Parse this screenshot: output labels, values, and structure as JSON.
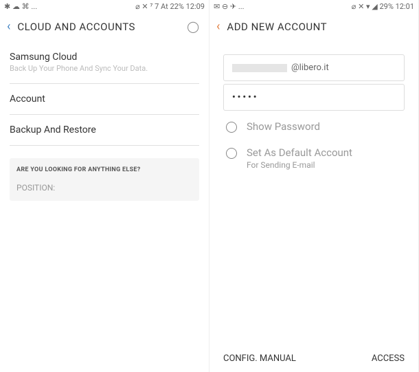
{
  "left": {
    "status": {
      "left_icons": "✱ ☁ ⌘ ...",
      "right_text": "⌀ ✕ ⁷ 7 At 22% 12:09"
    },
    "header": {
      "title": "CLOUD AND ACCOUNTS"
    },
    "items": [
      {
        "title": "Samsung Cloud",
        "subtitle": "Back Up Your Phone And Sync Your Data."
      },
      {
        "title": "Account"
      },
      {
        "title": "Backup And Restore"
      }
    ],
    "searchbox": {
      "heading": "ARE YOU LOOKING FOR ANYTHING ELSE?",
      "position_label": "POSITION:"
    }
  },
  "right": {
    "status": {
      "left_icons": "✉ ⊖ ✈ ...",
      "right_text": "⌀ ✕ ▾ ◢ 29% 12:01"
    },
    "header": {
      "title": "ADD NEW ACCOUNT"
    },
    "form": {
      "email_domain": "@libero.it",
      "password_display": "•••••",
      "show_password_label": "Show Password",
      "default_account_label": "Set As Default Account",
      "default_account_sublabel": "For Sending E-mail"
    },
    "bottom": {
      "manual": "CONFIG. MANUAL",
      "access": "ACCESS"
    }
  }
}
